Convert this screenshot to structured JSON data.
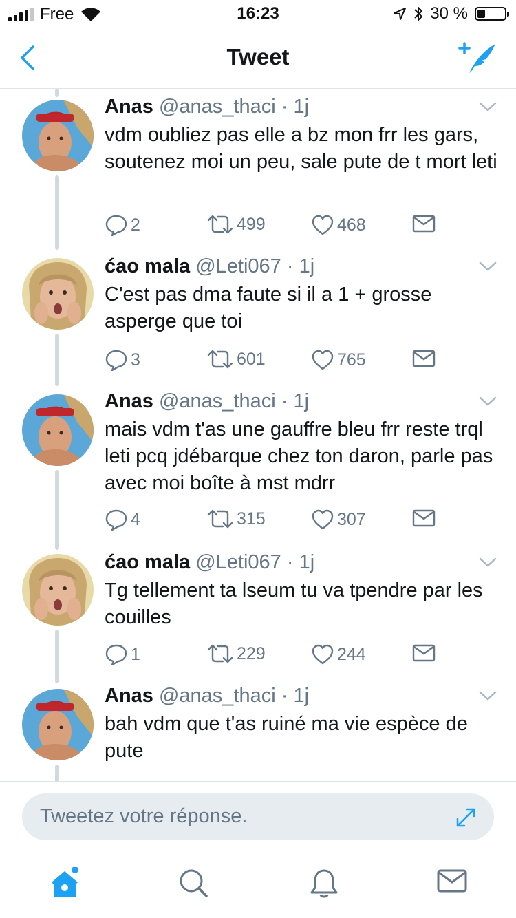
{
  "status_bar": {
    "carrier": "Free",
    "time": "16:23",
    "battery_percent": "30 %",
    "battery_level": 0.3
  },
  "nav": {
    "title": "Tweet",
    "back_icon": "chevron-left-icon",
    "compose_icon": "compose-tweet-icon"
  },
  "colors": {
    "accent": "#1da1f2",
    "text": "#14171a",
    "secondary": "#657786",
    "thread_line": "#cfd9de"
  },
  "tweets": [
    {
      "name": "Anas",
      "handle": "@anas_thaci",
      "dot": "·",
      "time": "1j",
      "text": "vdm oubliez pas elle a bz mon frr les gars, soutenez moi un peu, sale pute de t mort leti",
      "replies": "2",
      "retweets": "499",
      "likes": "468"
    },
    {
      "name": "ćao mala",
      "handle": "@Leti067",
      "dot": "·",
      "time": "1j",
      "text": "C'est pas dma faute si il a 1 + grosse asperge que toi",
      "replies": "3",
      "retweets": "601",
      "likes": "765"
    },
    {
      "name": "Anas",
      "handle": "@anas_thaci",
      "dot": "·",
      "time": "1j",
      "text": "mais vdm t'as une gauffre bleu frr reste trql leti pcq jdébarque chez ton daron, parle pas avec moi boîte à mst mdrr",
      "replies": "4",
      "retweets": "315",
      "likes": "307"
    },
    {
      "name": "ćao mala",
      "handle": "@Leti067",
      "dot": "·",
      "time": "1j",
      "text": "Tg tellement ta lseum tu va tpendre par les couilles",
      "replies": "1",
      "retweets": "229",
      "likes": "244"
    },
    {
      "name": "Anas",
      "handle": "@anas_thaci",
      "dot": "·",
      "time": "1j",
      "text": "bah vdm que t'as ruiné ma vie espèce de pute"
    }
  ],
  "reply": {
    "placeholder": "Tweetez votre réponse.",
    "expand_icon": "expand-arrows-icon"
  },
  "tabs": [
    {
      "name": "home",
      "icon": "home-icon",
      "active": true
    },
    {
      "name": "search",
      "icon": "search-icon",
      "active": false
    },
    {
      "name": "notifications",
      "icon": "bell-icon",
      "active": false
    },
    {
      "name": "messages",
      "icon": "envelope-icon",
      "active": false
    }
  ]
}
